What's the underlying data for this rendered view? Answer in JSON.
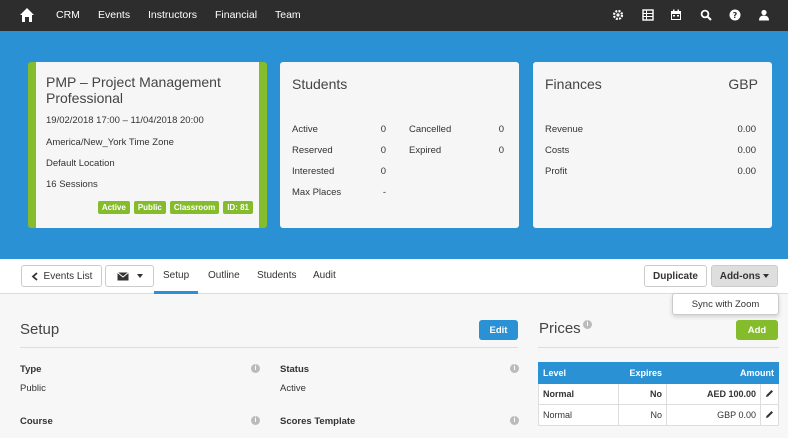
{
  "nav": {
    "items": [
      "CRM",
      "Events",
      "Instructors",
      "Financial",
      "Team"
    ],
    "icons": [
      "home-icon",
      "gear-icon",
      "table-icon",
      "calendar-icon",
      "search-icon",
      "help-icon",
      "user-icon"
    ]
  },
  "event": {
    "title": "PMP – Project Management Professional",
    "dates": "19/02/2018 17:00 – 11/04/2018 20:00",
    "timezone": "America/New_York Time Zone",
    "location": "Default Location",
    "sessions": "16 Sessions",
    "badges": [
      "Active",
      "Public",
      "Classroom",
      "ID: 81"
    ]
  },
  "students": {
    "title": "Students",
    "left": [
      {
        "label": "Active",
        "value": "0"
      },
      {
        "label": "Reserved",
        "value": "0"
      },
      {
        "label": "Interested",
        "value": "0"
      },
      {
        "label": "Max Places",
        "value": "-"
      }
    ],
    "right": [
      {
        "label": "Cancelled",
        "value": "0"
      },
      {
        "label": "Expired",
        "value": "0"
      }
    ]
  },
  "finances": {
    "title": "Finances",
    "currency": "GBP",
    "rows": [
      {
        "label": "Revenue",
        "value": "0.00"
      },
      {
        "label": "Costs",
        "value": "0.00"
      },
      {
        "label": "Profit",
        "value": "0.00"
      }
    ]
  },
  "tabbar": {
    "back_label": "Events List",
    "tabs": [
      "Setup",
      "Outline",
      "Students",
      "Audit"
    ],
    "duplicate_label": "Duplicate",
    "addons_label": "Add-ons",
    "dropdown_item": "Sync with Zoom"
  },
  "setup": {
    "title": "Setup",
    "edit_label": "Edit",
    "type_label": "Type",
    "type_value": "Public",
    "status_label": "Status",
    "status_value": "Active",
    "course_label": "Course",
    "scores_label": "Scores Template"
  },
  "prices": {
    "title": "Prices",
    "add_label": "Add",
    "headers": [
      "Level",
      "Expires",
      "Amount"
    ],
    "rows": [
      {
        "level": "Normal",
        "expires": "No",
        "amount": "AED 100.00",
        "bold": true
      },
      {
        "level": "Normal",
        "expires": "No",
        "amount": "GBP 0.00",
        "bold": false
      }
    ]
  },
  "colors": {
    "nav_bg": "#2d2d2d",
    "hero_blue": "#2a92d4",
    "green": "#84bc2b"
  }
}
